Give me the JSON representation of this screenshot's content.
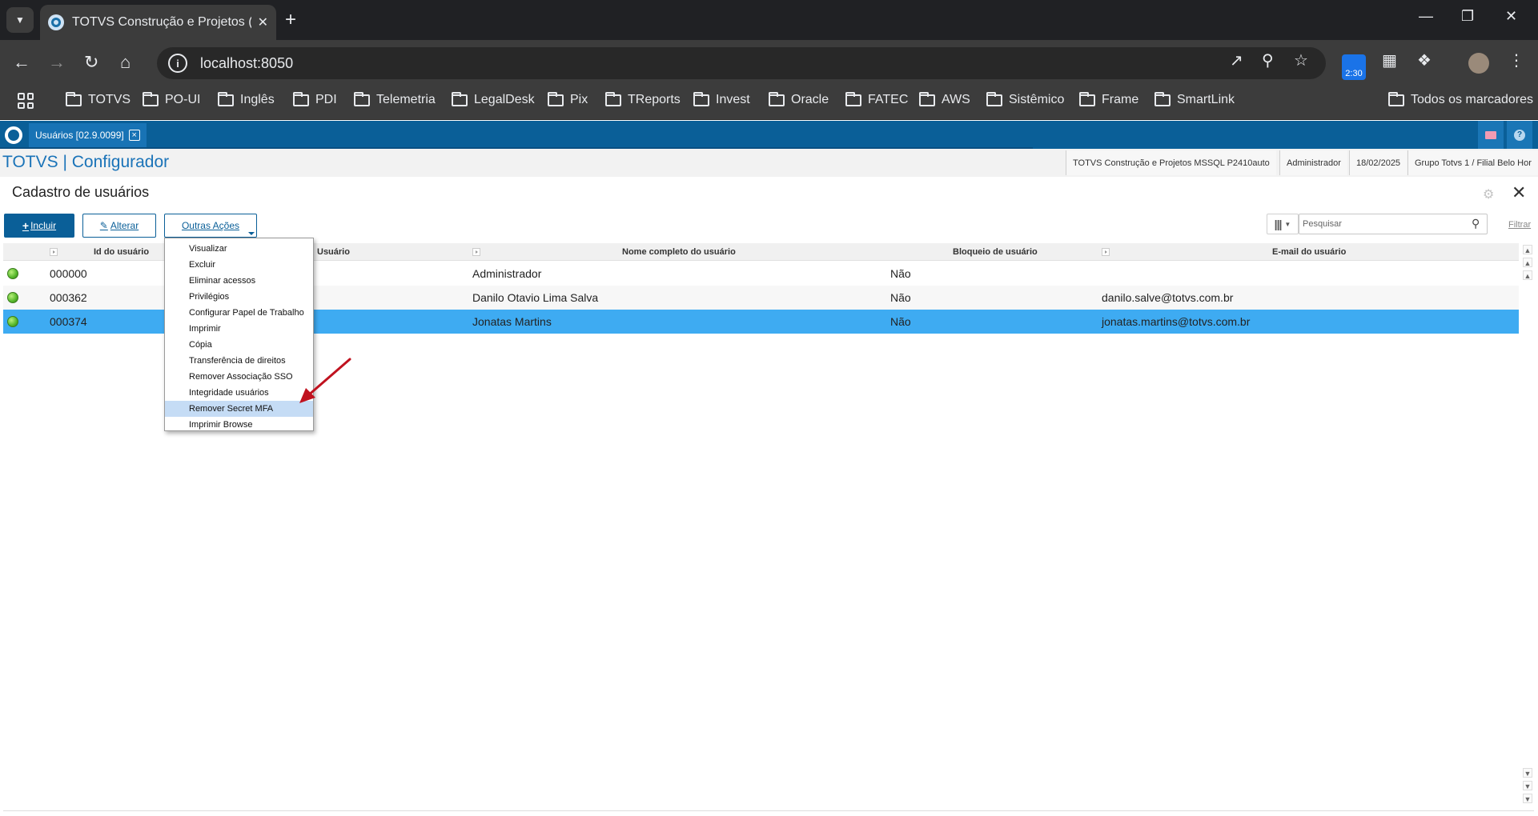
{
  "browser": {
    "tab_title": "TOTVS Construção e Projetos (T",
    "url": "localhost:8050",
    "ext_badge": "2:30",
    "bookmarks": [
      "TOTVS",
      "PO-UI",
      "Inglês",
      "PDI",
      "Telemetria",
      "LegalDesk",
      "Pix",
      "TReports",
      "Invest",
      "Oracle",
      "FATEC",
      "AWS",
      "Sistêmico",
      "Frame",
      "SmartLink"
    ],
    "all_bookmarks": "Todos os marcadores"
  },
  "app": {
    "tab_label": "Usuários [02.9.0099]",
    "brand": "TOTVS | Configurador",
    "info": {
      "company": "TOTVS Construção e Projetos MSSQL P2410auto",
      "user": "Administrador",
      "date": "18/02/2025",
      "branch": "Grupo Totvs 1 / Filial Belo Hor"
    }
  },
  "page": {
    "title": "Cadastro de usuários",
    "buttons": {
      "include": "Incluir",
      "edit": "Alterar",
      "more": "Outras Ações"
    },
    "search_placeholder": "Pesquisar",
    "filter_label": "Filtrar"
  },
  "grid": {
    "columns": [
      "Id do usuário",
      "Usuário",
      "Nome completo do usuário",
      "Bloqueio de usuário",
      "E-mail do usuário"
    ],
    "rows": [
      {
        "id": "000000",
        "name": "Administrador",
        "blocked": "Não",
        "email": ""
      },
      {
        "id": "000362",
        "name": "Danilo Otavio Lima Salva",
        "blocked": "Não",
        "email": "danilo.salve@totvs.com.br"
      },
      {
        "id": "000374",
        "name": "Jonatas Martins",
        "blocked": "Não",
        "email": "jonatas.martins@totvs.com.br"
      }
    ],
    "status_color": "#54b62a",
    "selected_row_color": "#3eabf2"
  },
  "menu": {
    "items": [
      "Visualizar",
      "Excluir",
      "Eliminar acessos",
      "Privilégios",
      "Configurar Papel de Trabalho",
      "Imprimir",
      "Cópia",
      "Transferência de direitos",
      "Remover Associação SSO",
      "Integridade usuários",
      "Remover Secret MFA",
      "Imprimir Browse"
    ],
    "highlighted": "Remover Secret MFA"
  },
  "colors": {
    "brand_blue": "#0a5f98",
    "annotation_arrow": "#c0121f"
  }
}
